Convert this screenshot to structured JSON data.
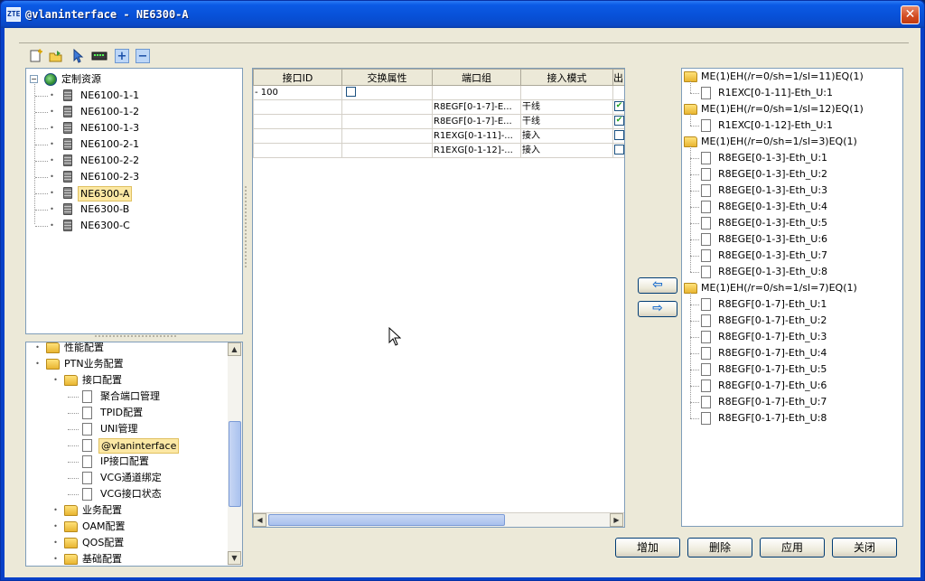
{
  "window": {
    "title": "@vlaninterface - NE6300-A",
    "app_icon_text": "ZTE",
    "close_glyph": "✕"
  },
  "toolbar": {
    "icons": [
      "new-icon",
      "open-icon",
      "pointer-icon",
      "device-icon",
      "expand-icon",
      "collapse-icon"
    ],
    "expand_glyph": "+",
    "collapse_glyph": "−"
  },
  "resource_tree": {
    "root": "定制资源",
    "items": [
      "NE6100-1-1",
      "NE6100-1-2",
      "NE6100-1-3",
      "NE6100-2-1",
      "NE6100-2-2",
      "NE6100-2-3",
      "NE6300-A",
      "NE6300-B",
      "NE6300-C"
    ],
    "selected": "NE6300-A"
  },
  "function_tree": {
    "items": [
      {
        "label": "性能配置",
        "level": 0,
        "type": "folder"
      },
      {
        "label": "PTN业务配置",
        "level": 0,
        "type": "folder"
      },
      {
        "label": "接口配置",
        "level": 1,
        "type": "folder"
      },
      {
        "label": "聚合端口管理",
        "level": 2,
        "type": "doc"
      },
      {
        "label": "TPID配置",
        "level": 2,
        "type": "doc"
      },
      {
        "label": "UNI管理",
        "level": 2,
        "type": "doc"
      },
      {
        "label": "@vlaninterface",
        "level": 2,
        "type": "doc"
      },
      {
        "label": "IP接口配置",
        "level": 2,
        "type": "doc"
      },
      {
        "label": "VCG通道绑定",
        "level": 2,
        "type": "doc"
      },
      {
        "label": "VCG接口状态",
        "level": 2,
        "type": "doc"
      },
      {
        "label": "业务配置",
        "level": 1,
        "type": "folder"
      },
      {
        "label": "OAM配置",
        "level": 1,
        "type": "folder"
      },
      {
        "label": "QOS配置",
        "level": 1,
        "type": "folder"
      },
      {
        "label": "基础配置",
        "level": 1,
        "type": "folder"
      }
    ],
    "selected": "@vlaninterface"
  },
  "table": {
    "columns": [
      "接口ID",
      "交换属性",
      "端口组",
      "接入模式",
      "出"
    ],
    "rows": [
      {
        "id": "- 100",
        "swap": "",
        "port": "",
        "mode": "",
        "out": ""
      },
      {
        "id": "",
        "swap": "",
        "port": "R8EGF[0-1-7]-E...",
        "mode": "干线",
        "out": "✔"
      },
      {
        "id": "",
        "swap": "",
        "port": "R8EGF[0-1-7]-E...",
        "mode": "干线",
        "out": "✔"
      },
      {
        "id": "",
        "swap": "",
        "port": "R1EXG[0-1-11]-...",
        "mode": "接入",
        "out": ""
      },
      {
        "id": "",
        "swap": "",
        "port": "R1EXG[0-1-12]-...",
        "mode": "接入",
        "out": ""
      }
    ]
  },
  "transfer": {
    "left_glyph": "⇦",
    "right_glyph": "⇨"
  },
  "port_tree": {
    "groups": [
      {
        "label": "ME(1)EH(/r=0/sh=1/sl=11)EQ(1)",
        "ports": [
          "R1EXC[0-1-11]-Eth_U:1"
        ]
      },
      {
        "label": "ME(1)EH(/r=0/sh=1/sl=12)EQ(1)",
        "ports": [
          "R1EXC[0-1-12]-Eth_U:1"
        ]
      },
      {
        "label": "ME(1)EH(/r=0/sh=1/sl=3)EQ(1)",
        "ports": [
          "R8EGE[0-1-3]-Eth_U:1",
          "R8EGE[0-1-3]-Eth_U:2",
          "R8EGE[0-1-3]-Eth_U:3",
          "R8EGE[0-1-3]-Eth_U:4",
          "R8EGE[0-1-3]-Eth_U:5",
          "R8EGE[0-1-3]-Eth_U:6",
          "R8EGE[0-1-3]-Eth_U:7",
          "R8EGE[0-1-3]-Eth_U:8"
        ]
      },
      {
        "label": "ME(1)EH(/r=0/sh=1/sl=7)EQ(1)",
        "ports": [
          "R8EGF[0-1-7]-Eth_U:1",
          "R8EGF[0-1-7]-Eth_U:2",
          "R8EGF[0-1-7]-Eth_U:3",
          "R8EGF[0-1-7]-Eth_U:4",
          "R8EGF[0-1-7]-Eth_U:5",
          "R8EGF[0-1-7]-Eth_U:6",
          "R8EGF[0-1-7]-Eth_U:7",
          "R8EGF[0-1-7]-Eth_U:8"
        ]
      }
    ]
  },
  "buttons": {
    "add": "增加",
    "delete": "删除",
    "apply": "应用",
    "close": "关闭"
  },
  "scroll_glyphs": {
    "up": "▲",
    "down": "▼",
    "left": "◀",
    "right": "▶"
  },
  "colors": {
    "title_bar": "#0850d6",
    "selection": "#fce8a4",
    "dialog_bg": "#ece9d8"
  }
}
